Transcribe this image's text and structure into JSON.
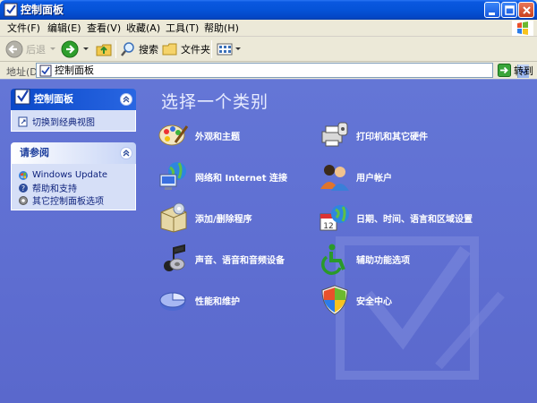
{
  "window": {
    "title": "控制面板"
  },
  "menu": [
    "文件(F)",
    "编辑(E)",
    "查看(V)",
    "收藏(A)",
    "工具(T)",
    "帮助(H)"
  ],
  "toolbar": {
    "back_label": "后退",
    "search_label": "搜索",
    "folders_label": "文件夹"
  },
  "address": {
    "label": "地址(D)",
    "value": "控制面板",
    "go_label": "转到"
  },
  "panels": {
    "control_panel": {
      "title": "控制面板",
      "items": [
        "切换到经典视图"
      ]
    },
    "see_also": {
      "title": "请参阅",
      "items": [
        "Windows Update",
        "帮助和支持",
        "其它控制面板选项"
      ]
    }
  },
  "main": {
    "title": "选择一个类别",
    "categories": [
      {
        "label": "外观和主题",
        "icon": "appearance-icon"
      },
      {
        "label": "打印机和其它硬件",
        "icon": "printer-icon"
      },
      {
        "label": "网络和 Internet 连接",
        "icon": "network-icon"
      },
      {
        "label": "用户帐户",
        "icon": "users-icon"
      },
      {
        "label": "添加/删除程序",
        "icon": "add-remove-icon"
      },
      {
        "label": "日期、时间、语言和区域设置",
        "icon": "date-time-icon"
      },
      {
        "label": "声音、语音和音频设备",
        "icon": "sound-icon"
      },
      {
        "label": "辅助功能选项",
        "icon": "accessibility-icon"
      },
      {
        "label": "性能和维护",
        "icon": "performance-icon"
      },
      {
        "label": "安全中心",
        "icon": "security-icon"
      }
    ]
  },
  "colors": {
    "titlebar": "#0553d8",
    "content_bg": "#6476d6",
    "panel_body": "#d6dff7"
  }
}
